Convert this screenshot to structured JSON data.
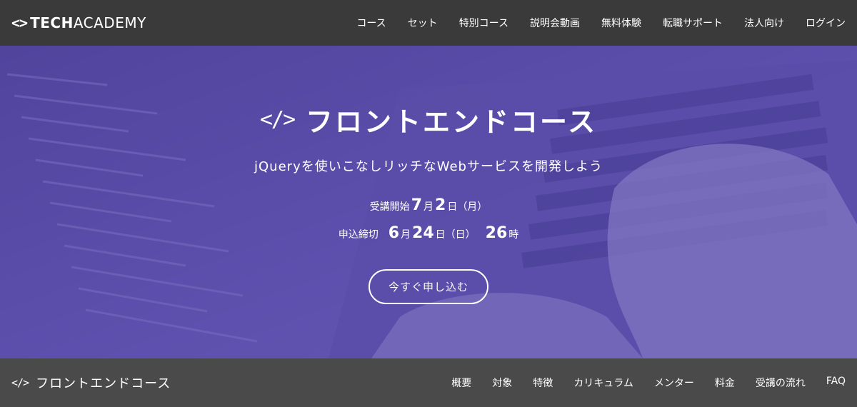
{
  "header": {
    "logo_mark": "<>",
    "logo_bold": "TECH",
    "logo_light": "ACADEMY",
    "nav": [
      {
        "label": "コース"
      },
      {
        "label": "セット"
      },
      {
        "label": "特別コース"
      },
      {
        "label": "説明会動画"
      },
      {
        "label": "無料体験"
      },
      {
        "label": "転職サポート"
      },
      {
        "label": "法人向け"
      },
      {
        "label": "ログイン"
      }
    ]
  },
  "hero": {
    "icon": "</>",
    "title": "フロントエンドコース",
    "subtitle": "jQueryを使いこなしリッチなWebサービスを開発しよう",
    "start": {
      "label": "受講開始",
      "month": "7",
      "month_unit": "月",
      "day": "2",
      "day_unit": "日",
      "weekday": "（月）"
    },
    "deadline": {
      "label": "申込締切",
      "month": "6",
      "month_unit": "月",
      "day": "24",
      "day_unit": "日",
      "weekday": "（日）",
      "hour": "26",
      "hour_unit": "時"
    },
    "cta_label": "今すぐ申し込む"
  },
  "subbar": {
    "icon": "</>",
    "title": "フロントエンドコース",
    "nav": [
      {
        "label": "概要"
      },
      {
        "label": "対象"
      },
      {
        "label": "特徴"
      },
      {
        "label": "カリキュラム"
      },
      {
        "label": "メンター"
      },
      {
        "label": "料金"
      },
      {
        "label": "受講の流れ"
      },
      {
        "label": "FAQ"
      }
    ]
  }
}
